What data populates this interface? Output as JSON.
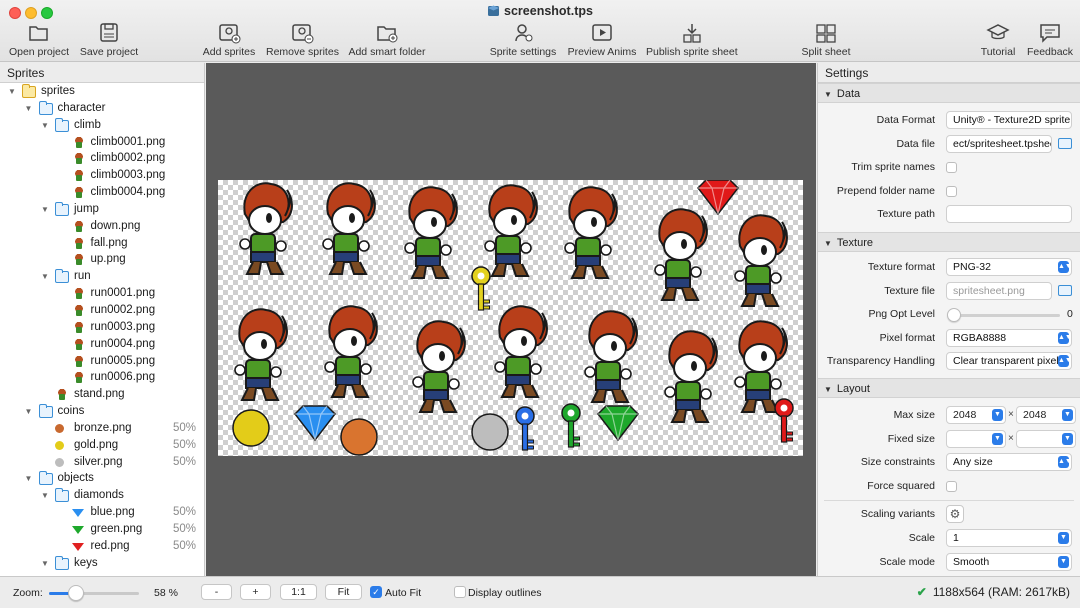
{
  "window": {
    "title": "screenshot.tps"
  },
  "toolbar": {
    "open_project": "Open project",
    "save_project": "Save project",
    "add_sprites": "Add sprites",
    "remove_sprites": "Remove sprites",
    "add_smart_folder": "Add smart folder",
    "sprite_settings": "Sprite settings",
    "preview_anims": "Preview Anims",
    "publish_sprite_sheet": "Publish sprite sheet",
    "split_sheet": "Split sheet",
    "tutorial": "Tutorial",
    "feedback": "Feedback"
  },
  "sprites_panel": {
    "header": "Sprites",
    "tree": [
      {
        "name": "sprites",
        "type": "folder-gold",
        "level": 0,
        "expanded": true
      },
      {
        "name": "character",
        "type": "folder",
        "level": 1,
        "expanded": true
      },
      {
        "name": "climb",
        "type": "folder",
        "level": 2,
        "expanded": true
      },
      {
        "name": "climb0001.png",
        "type": "sprite",
        "level": 3
      },
      {
        "name": "climb0002.png",
        "type": "sprite",
        "level": 3
      },
      {
        "name": "climb0003.png",
        "type": "sprite",
        "level": 3
      },
      {
        "name": "climb0004.png",
        "type": "sprite",
        "level": 3
      },
      {
        "name": "jump",
        "type": "folder",
        "level": 2,
        "expanded": true
      },
      {
        "name": "down.png",
        "type": "sprite",
        "level": 3
      },
      {
        "name": "fall.png",
        "type": "sprite",
        "level": 3
      },
      {
        "name": "up.png",
        "type": "sprite",
        "level": 3
      },
      {
        "name": "run",
        "type": "folder",
        "level": 2,
        "expanded": true
      },
      {
        "name": "run0001.png",
        "type": "sprite",
        "level": 3
      },
      {
        "name": "run0002.png",
        "type": "sprite",
        "level": 3
      },
      {
        "name": "run0003.png",
        "type": "sprite",
        "level": 3
      },
      {
        "name": "run0004.png",
        "type": "sprite",
        "level": 3
      },
      {
        "name": "run0005.png",
        "type": "sprite",
        "level": 3
      },
      {
        "name": "run0006.png",
        "type": "sprite",
        "level": 3
      },
      {
        "name": "stand.png",
        "type": "sprite",
        "level": 2
      },
      {
        "name": "coins",
        "type": "folder",
        "level": 1,
        "expanded": true
      },
      {
        "name": "bronze.png",
        "type": "coin",
        "color": "#c8692f",
        "level": 2,
        "scale": "50%"
      },
      {
        "name": "gold.png",
        "type": "coin",
        "color": "#e3cc19",
        "level": 2,
        "scale": "50%"
      },
      {
        "name": "silver.png",
        "type": "coin",
        "color": "#bdbdbd",
        "level": 2,
        "scale": "50%"
      },
      {
        "name": "objects",
        "type": "folder",
        "level": 1,
        "expanded": true
      },
      {
        "name": "diamonds",
        "type": "folder",
        "level": 2,
        "expanded": true
      },
      {
        "name": "blue.png",
        "type": "gem",
        "color": "#2a8ff0",
        "level": 3,
        "scale": "50%"
      },
      {
        "name": "green.png",
        "type": "gem",
        "color": "#1ea82c",
        "level": 3,
        "scale": "50%"
      },
      {
        "name": "red.png",
        "type": "gem",
        "color": "#e02020",
        "level": 3,
        "scale": "50%"
      },
      {
        "name": "keys",
        "type": "folder",
        "level": 2,
        "expanded": true
      }
    ]
  },
  "settings": {
    "header": "Settings",
    "data_section": {
      "title": "Data",
      "data_format_label": "Data Format",
      "data_format_value": "Unity® - Texture2D sprite",
      "data_file_label": "Data file",
      "data_file_value": "ect/spritesheet.tpsheet",
      "trim_sprite_names_label": "Trim sprite names",
      "prepend_folder_name_label": "Prepend folder name",
      "texture_path_label": "Texture path",
      "texture_path_value": ""
    },
    "texture_section": {
      "title": "Texture",
      "texture_format_label": "Texture format",
      "texture_format_value": "PNG-32",
      "texture_file_label": "Texture file",
      "texture_file_value": "spritesheet.png",
      "png_opt_level_label": "Png Opt Level",
      "png_opt_level_value": "0",
      "pixel_format_label": "Pixel format",
      "pixel_format_value": "RGBA8888",
      "transparency_label": "Transparency Handling",
      "transparency_value": "Clear transparent pixels"
    },
    "layout_section": {
      "title": "Layout",
      "max_size_label": "Max size",
      "max_size_w": "2048",
      "max_size_h": "2048",
      "times": "×",
      "fixed_size_label": "Fixed size",
      "size_constraints_label": "Size constraints",
      "size_constraints_value": "Any size",
      "force_squared_label": "Force squared",
      "scaling_variants_label": "Scaling variants",
      "scale_label": "Scale",
      "scale_value": "1",
      "scale_mode_label": "Scale mode",
      "scale_mode_value": "Smooth"
    }
  },
  "statusbar": {
    "zoom_label": "Zoom:",
    "zoom_value": "58 %",
    "zoom_fraction": 0.3,
    "zoom_out": "-",
    "zoom_in": "+",
    "one_to_one": "1:1",
    "fit": "Fit",
    "auto_fit_label": "Auto Fit",
    "auto_fit_checked": true,
    "display_outlines_label": "Display outlines",
    "display_outlines_checked": false,
    "size_info": "1188x564 (RAM: 2617kB)"
  },
  "colors": {
    "accent": "#2b7ce9",
    "canvas_bg": "#5a5a5a",
    "ok": "#2aa34a"
  },
  "icons": {
    "open_project": "folder-open-icon",
    "save_project": "save-icon",
    "add_sprites": "add-image-icon",
    "remove_sprites": "remove-image-icon",
    "add_smart_folder": "smart-folder-icon",
    "sprite_settings": "sprite-settings-icon",
    "preview_anims": "play-icon",
    "publish": "publish-icon",
    "split_sheet": "split-sheet-icon",
    "tutorial": "graduation-cap-icon",
    "feedback": "speech-bubble-icon"
  }
}
